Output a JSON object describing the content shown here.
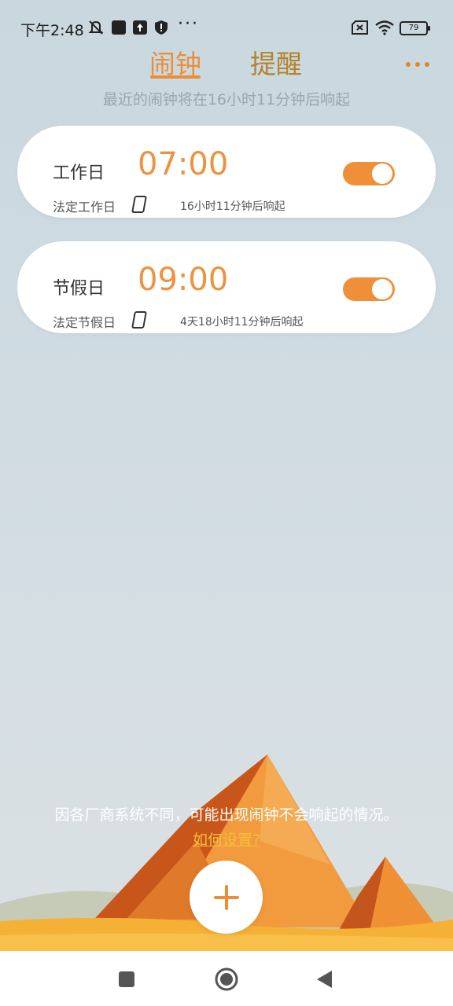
{
  "status_bar": {
    "time": "下午2:48",
    "more": "···",
    "battery": "79",
    "icons": [
      "muted-bell-icon",
      "square-notification-icon",
      "upload-icon",
      "shield-icon",
      "sim-off-icon",
      "wifi-icon",
      "battery-icon"
    ]
  },
  "tabs": [
    {
      "label": "闹钟",
      "active": true
    },
    {
      "label": "提醒",
      "active": false
    }
  ],
  "menu_icon": "more-horizontal-icon",
  "subtitle": "最近的闹钟将在16小时11分钟后响起",
  "alarms": [
    {
      "label": "工作日",
      "time": "07:00",
      "repeat": "法定工作日",
      "countdown": "16小时11分钟后响起",
      "enabled": true
    },
    {
      "label": "节假日",
      "time": "09:00",
      "repeat": "法定节假日",
      "countdown": "4天18小时11分钟后响起",
      "enabled": true
    }
  ],
  "notice": "因各厂商系统不同，可能出现闹钟不会响起的情况。",
  "help_link": "如何设置?",
  "fab_icon": "plus-icon",
  "nav": [
    "recents-square-icon",
    "home-circle-icon",
    "back-triangle-icon"
  ],
  "colors": {
    "accent": "#ED8E36",
    "inactive_tab": "#B4832C",
    "link": "#F5BF3A"
  }
}
